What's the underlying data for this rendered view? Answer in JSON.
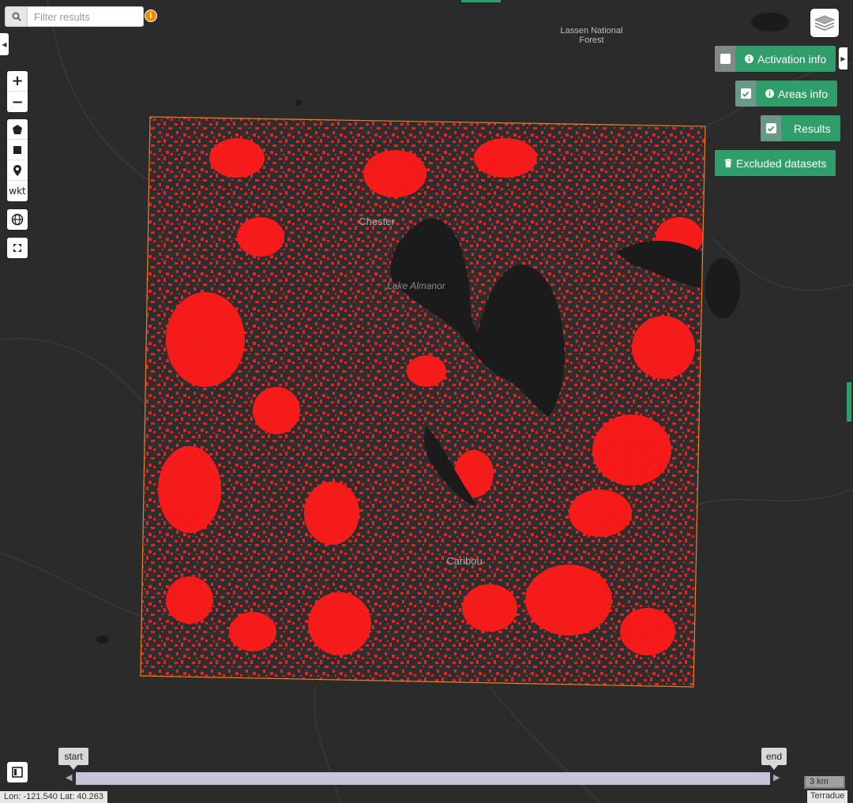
{
  "colors": {
    "map_bg": "#2b2b2b",
    "result_red": "#ff1a1a",
    "aoi_border": "#e8801e",
    "lake": "#1b1b1b",
    "accent_green": "#2f9e6a",
    "info_orange": "#f08c00"
  },
  "search": {
    "placeholder": "Filter results",
    "icon": "search-icon",
    "info_icon_glyph": "i"
  },
  "map_labels": {
    "forest": "Lassen National\nForest",
    "chester": "Chester",
    "lake_almanor": "Lake Almanor",
    "caribou": "Caribou"
  },
  "controls": {
    "zoom_in": "+",
    "zoom_out": "−",
    "wkt": "wkt"
  },
  "panel": {
    "activation_info": {
      "label": "Activation info",
      "checked": false
    },
    "areas_info": {
      "label": "Areas info",
      "checked": true
    },
    "results": {
      "label": "Results",
      "checked": true
    },
    "excluded_datasets": {
      "label": "Excluded datasets"
    }
  },
  "timeline": {
    "start_label": "start",
    "end_label": "end"
  },
  "status": {
    "coordinates": "Lon: -121.540 Lat: 40.263",
    "scale": "3 km",
    "attribution": "Terradue"
  }
}
